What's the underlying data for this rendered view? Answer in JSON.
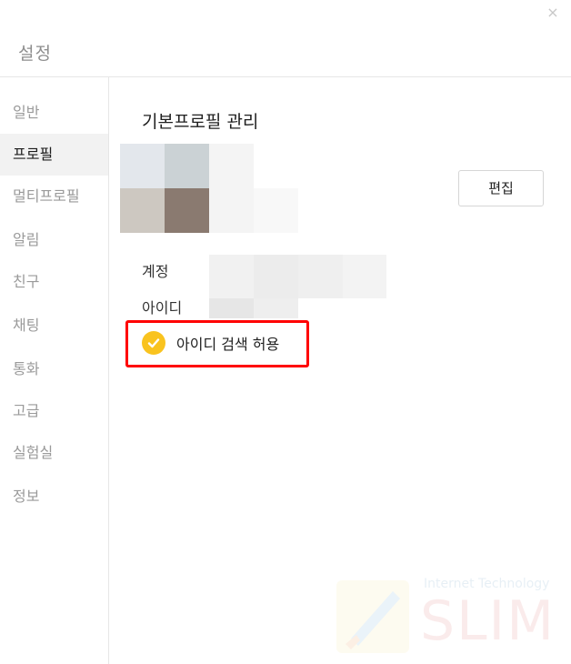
{
  "window": {
    "title": "설정",
    "close_glyph": "×"
  },
  "sidebar": {
    "items": [
      {
        "label": "일반",
        "active": false
      },
      {
        "label": "프로필",
        "active": true
      },
      {
        "label": "멀티프로필",
        "active": false
      },
      {
        "label": "알림",
        "active": false
      },
      {
        "label": "친구",
        "active": false
      },
      {
        "label": "채팅",
        "active": false
      },
      {
        "label": "통화",
        "active": false
      },
      {
        "label": "고급",
        "active": false
      },
      {
        "label": "실험실",
        "active": false
      },
      {
        "label": "정보",
        "active": false
      }
    ]
  },
  "profile": {
    "section_title": "기본프로필 관리",
    "edit_label": "편집",
    "account_label": "계정",
    "id_label": "아이디",
    "allow_id_search_label": "아이디 검색 허용",
    "allow_id_search_checked": true
  },
  "watermark": {
    "small_text": "Internet Technology",
    "big_text": "SLIM"
  },
  "colors": {
    "accent_yellow": "#f9c31f",
    "highlight_red": "#ff0000",
    "active_nav_bg": "#f2f2f2"
  },
  "icons": {
    "close": "close-icon",
    "check": "check-icon",
    "watermark_logo": "rocket-icon"
  }
}
